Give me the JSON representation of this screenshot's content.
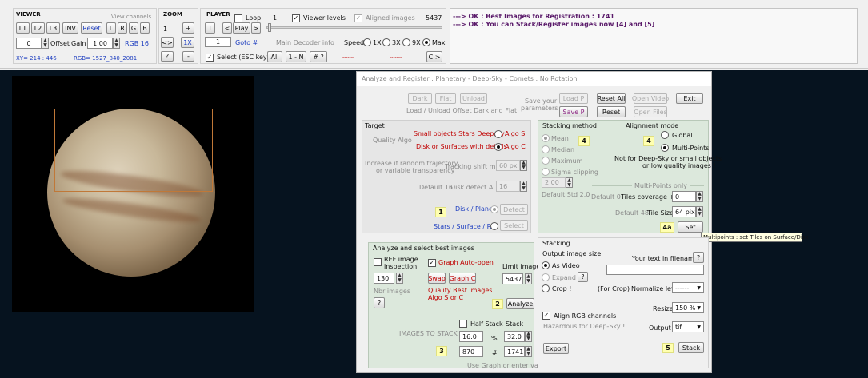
{
  "viewer": {
    "title": "VIEWER",
    "view_channels": "View channels",
    "l1": "L1",
    "l2": "L2",
    "l3": "L3",
    "inv": "INV",
    "reset": "Reset",
    "l": "L",
    "r": "R",
    "g": "G",
    "b": "B",
    "offset_val": "0",
    "offset_label": "Offset",
    "gain_label": "Gain",
    "gain_val": "1.00",
    "rgb_bits": "RGB 16",
    "xy": "XY= 214 : 446",
    "rgb": "RGB= 1527_840_2081"
  },
  "zoom": {
    "title": "ZOOM",
    "val": "1",
    "plus": "+",
    "fit": "<>",
    "one_x": "1X",
    "help": "?",
    "minus": "-"
  },
  "player": {
    "title": "PLAYER",
    "loop": "Loop",
    "frame": "1",
    "viewer_levels": "Viewer levels",
    "aligned_images": "Aligned images",
    "total": "5437",
    "first": "1",
    "prev": "<",
    "play": "Play",
    "next": ">",
    "goto_val": "1",
    "goto": "Goto #",
    "main_decoder": "Main Decoder info",
    "speed": "Speed",
    "speeds": [
      "1X",
      "3X",
      "9X",
      "Max"
    ],
    "select": "Select (ESC key)",
    "all": "All",
    "one_n": "1 - N",
    "hash": "# ?",
    "dashes1": "-------",
    "dashes2": "-------",
    "cmore": "C >"
  },
  "log": {
    "line1": "---> OK :   Best Images for Registration :  1741",
    "line2": "---> OK :   You can Stack/Register images now   [4] and [5]"
  },
  "dialog": {
    "title": "Analyze and Register :   Planetary - Deep-Sky - Comets :   No Rotation",
    "dark": "Dark",
    "flat": "Flat",
    "unload": "Unload",
    "load_hint": "Load / Unload Offset Dark and Flat",
    "save_params_1": "Save your",
    "save_params_2": "parameters",
    "load_p": "Load P",
    "save_p": "Save P",
    "reset_all": "Reset All",
    "reset": "Reset",
    "open_video": "Open Video",
    "open_files": "Open Files",
    "exit": "Exit",
    "target": {
      "title": "Target",
      "small_objects": "Small objects  Stars  Deepsky",
      "algo_s": "Algo S",
      "quality_algo": "Quality Algo",
      "disk_surfaces": "Disk or Surfaces with details",
      "algo_c": "Algo C",
      "increase_1": "Increase if random trajectory",
      "increase_2": "or variable transparency",
      "tracking_shift": "Tracking shift max",
      "tracking_val": "60 px",
      "default16": "Default 16",
      "disk_detect": "Disk detect ADU",
      "disk_detect_val": "16",
      "marker1": "1",
      "disk_planet": "Disk / Planet",
      "detect": "Detect",
      "stars_surface": "Stars / Surface / Roi",
      "select": "Select"
    },
    "stacking_method": {
      "title": "Stacking method",
      "marker": "4",
      "mean": "Mean",
      "median": "Median",
      "maximum": "Maximum",
      "sigma": "Sigma clipping",
      "sigma_val": "2.00",
      "default_sd": "Default Std 2.0"
    },
    "alignment": {
      "title": "Alignment mode",
      "marker": "4",
      "global": "Global",
      "multi": "Multi-Points",
      "note_1": "Not for Deep-Sky or small objects",
      "note_2": "or low quality images !",
      "mp_only": "Multi-Points only",
      "default0": "Default 0",
      "tiles_cov": "Tiles coverage +/-",
      "tiles_cov_val": "0",
      "default48": "Default 48",
      "tile_size": "Tile Size",
      "tile_size_val": "64 pix",
      "marker4a": "4a",
      "set": "Set",
      "tooltip": "Multipoints : set Tiles on Surface/Disk"
    },
    "analyze": {
      "title": "Analyze and select best images",
      "ref_1": "REF image",
      "ref_2": "inspection",
      "graph_auto": "Graph Auto-open",
      "limit": "Limit images",
      "nbr_val": "130",
      "nbr_label": "Nbr images",
      "swap": "Swap",
      "graph_c": "Graph C",
      "quality_1": "Quality Best images",
      "quality_2": "Algo S or C",
      "limit_val": "5437",
      "help": "?",
      "marker2": "2",
      "analyze": "Analyze",
      "half_stack": "Half Stack",
      "stack": "Stack",
      "to_stack": "IMAGES TO STACK",
      "pct1": "16.0",
      "pct_sign": "%",
      "pct2": "32.0",
      "marker3": "3",
      "n1": "870",
      "hash": "#",
      "n2": "1741",
      "use_graph": "Use Graph or enter value"
    },
    "stacking": {
      "title": "Stacking",
      "output_size": "Output image size",
      "as_video": "As Video",
      "expand": "Expand",
      "help1": "?",
      "crop": "Crop !",
      "for_crop": "(For Crop)",
      "normalize": "Normalize level",
      "normalize_val": "------",
      "text_fn": "Your text in filenames",
      "help2": "?",
      "resize": "Resize",
      "resize_val": "150 %",
      "align_rgb": "Align RGB channels",
      "hazardous": "Hazardous for Deep-Sky !",
      "output": "Output",
      "output_val": "tif",
      "export": "Export",
      "marker5": "5",
      "stack": "Stack"
    }
  },
  "colors": {
    "toolbar_bg": "#f0f0f0",
    "log_text": "#5a1a6a",
    "viewer_bg": "#06131f",
    "dialog_green": "#dce8dc",
    "marker_yellow": "#ffffb0",
    "accent_red": "#c00000",
    "accent_blue": "#2040c0"
  }
}
